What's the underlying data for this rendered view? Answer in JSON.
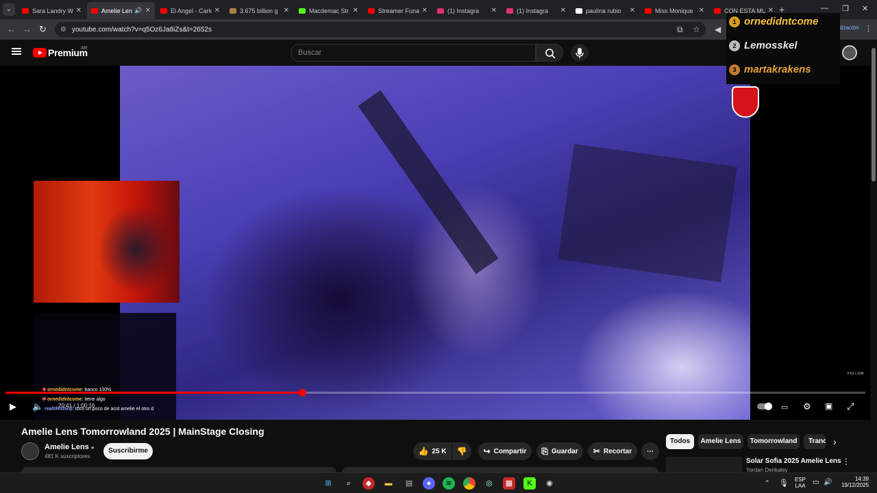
{
  "browser": {
    "tabs": [
      {
        "title": "Sara Landry W",
        "color": "#ff0000",
        "active": false
      },
      {
        "title": "Amelie Lens",
        "color": "#ff0000",
        "active": true,
        "audio": true
      },
      {
        "title": "El Angel - Carlo",
        "color": "#ff0000",
        "active": false
      },
      {
        "title": "3.675 billion g",
        "color": "#b08040",
        "active": false
      },
      {
        "title": "Macdemac Str",
        "color": "#53fc18",
        "active": false
      },
      {
        "title": "Streamer Funa",
        "color": "#ff0000",
        "active": false
      },
      {
        "title": "(1) Instagra",
        "color": "#e1306c",
        "active": false
      },
      {
        "title": "(1) Instagra",
        "color": "#e1306c",
        "active": false
      },
      {
        "title": "paulina rubio",
        "color": "#ffffff",
        "active": false
      },
      {
        "title": "Miss Monique",
        "color": "#ff0000",
        "active": false
      },
      {
        "title": "CON ESTA MU",
        "color": "#ff0000",
        "active": false
      }
    ],
    "url": "youtube.com/watch?v=q5Oz6Ja8iZs&t=2652s",
    "update_label": "ualización"
  },
  "youtube": {
    "brand": "Premium",
    "region": "AR",
    "search_placeholder": "Buscar"
  },
  "overlay": {
    "leaderboard": [
      {
        "rank": "1",
        "name": "ornedidntcome"
      },
      {
        "rank": "2",
        "name": "Lemosskel"
      },
      {
        "rank": "3",
        "name": "martakrakens"
      }
    ],
    "follow_label": "FOLLOW",
    "chat": [
      {
        "user": "ornedidntcome",
        "msg": ": banco 100%",
        "style": "u1"
      },
      {
        "user": "ornedidntcome",
        "msg": ": tiene algo",
        "style": "u1"
      },
      {
        "user": "reallifeshinji",
        "msg": ": toco un poco de acid amelie el otro d",
        "style": "u2"
      }
    ]
  },
  "player": {
    "progress_fraction": 0.345,
    "time_current": "20:41",
    "time_total": "1:00:16",
    "timecode": "20:41 / 1:00:16"
  },
  "video": {
    "title": "Amelie Lens Tomorrowland 2025 | MainStage Closing",
    "channel": "Amelie Lens",
    "subscribers": "481 K suscriptores",
    "subscribe_label": "Suscribirme",
    "likes": "25 K",
    "share_label": "Compartir",
    "save_label": "Guardar",
    "clip_label": "Recortar"
  },
  "recommendations": {
    "chips": [
      "Todos",
      "Amelie Lens",
      "Tomorrowland",
      "Trance"
    ],
    "first": {
      "title": "Solar Sofia 2025 Amelie Lens",
      "channel": "Yordan Denkaley"
    }
  },
  "taskbar": {
    "lang_top": "ESP",
    "lang_bottom": "LAA",
    "time": "14:39",
    "date": "19/12/2025"
  },
  "colors": {
    "accent": "#ff0000",
    "leaderboard_gold": "#f5c242"
  }
}
